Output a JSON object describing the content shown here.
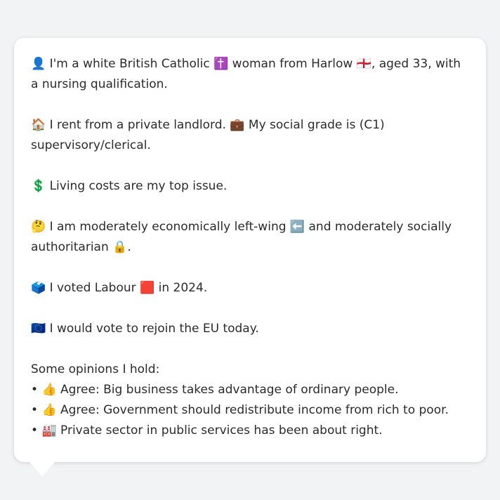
{
  "message": {
    "paragraphs": [
      {
        "parts": [
          {
            "kind": "emoji",
            "text": "👤",
            "name": "person-icon"
          },
          {
            "kind": "text",
            "text": " I'm a white British Catholic "
          },
          {
            "kind": "emoji",
            "text": "✝️",
            "name": "latin-cross-icon"
          },
          {
            "kind": "text",
            "text": " woman from Harlow "
          },
          {
            "kind": "emoji",
            "text": "🏴󠁧󠁢󠁥󠁮󠁧󠁿",
            "name": "england-flag-icon"
          },
          {
            "kind": "text",
            "text": ", aged 33, with a nursing qualification."
          }
        ]
      },
      {
        "parts": [
          {
            "kind": "emoji",
            "text": "🏠",
            "name": "house-icon"
          },
          {
            "kind": "text",
            "text": " I rent from a private landlord. "
          },
          {
            "kind": "emoji",
            "text": "💼",
            "name": "briefcase-icon"
          },
          {
            "kind": "text",
            "text": " My social grade is (C1) supervisory/clerical."
          }
        ]
      },
      {
        "parts": [
          {
            "kind": "emoji",
            "text": "💲",
            "name": "dollar-sign-icon"
          },
          {
            "kind": "text",
            "text": " Living costs are my top issue."
          }
        ]
      },
      {
        "parts": [
          {
            "kind": "emoji",
            "text": "🤔",
            "name": "thinking-face-icon"
          },
          {
            "kind": "text",
            "text": " I am moderately economically left-wing "
          },
          {
            "kind": "emoji",
            "text": "⬅️",
            "name": "left-arrow-icon"
          },
          {
            "kind": "text",
            "text": " and moderately socially authoritarian "
          },
          {
            "kind": "emoji",
            "text": "🔒",
            "name": "lock-icon"
          },
          {
            "kind": "text",
            "text": "."
          }
        ]
      },
      {
        "parts": [
          {
            "kind": "emoji",
            "text": "🗳️",
            "name": "ballot-box-icon"
          },
          {
            "kind": "text",
            "text": " I voted Labour "
          },
          {
            "kind": "emoji",
            "text": "🟥",
            "name": "red-square-icon"
          },
          {
            "kind": "text",
            "text": " in 2024."
          }
        ]
      },
      {
        "parts": [
          {
            "kind": "emoji",
            "text": "🇪🇺",
            "name": "eu-flag-icon"
          },
          {
            "kind": "text",
            "text": " I would vote to rejoin the EU today."
          }
        ]
      }
    ],
    "opinions_heading": "Some opinions I hold:",
    "opinions": [
      {
        "bullet": "•",
        "emoji": "👍",
        "emoji_name": "thumbs-up-icon",
        "text": " Agree: Big business takes advantage of ordinary people."
      },
      {
        "bullet": "•",
        "emoji": "👍",
        "emoji_name": "thumbs-up-icon",
        "text": " Agree: Government should redistribute income from rich to poor."
      },
      {
        "bullet": "•",
        "emoji": "🏭",
        "emoji_name": "factory-icon",
        "text": " Private sector in public services has been about right."
      }
    ]
  }
}
